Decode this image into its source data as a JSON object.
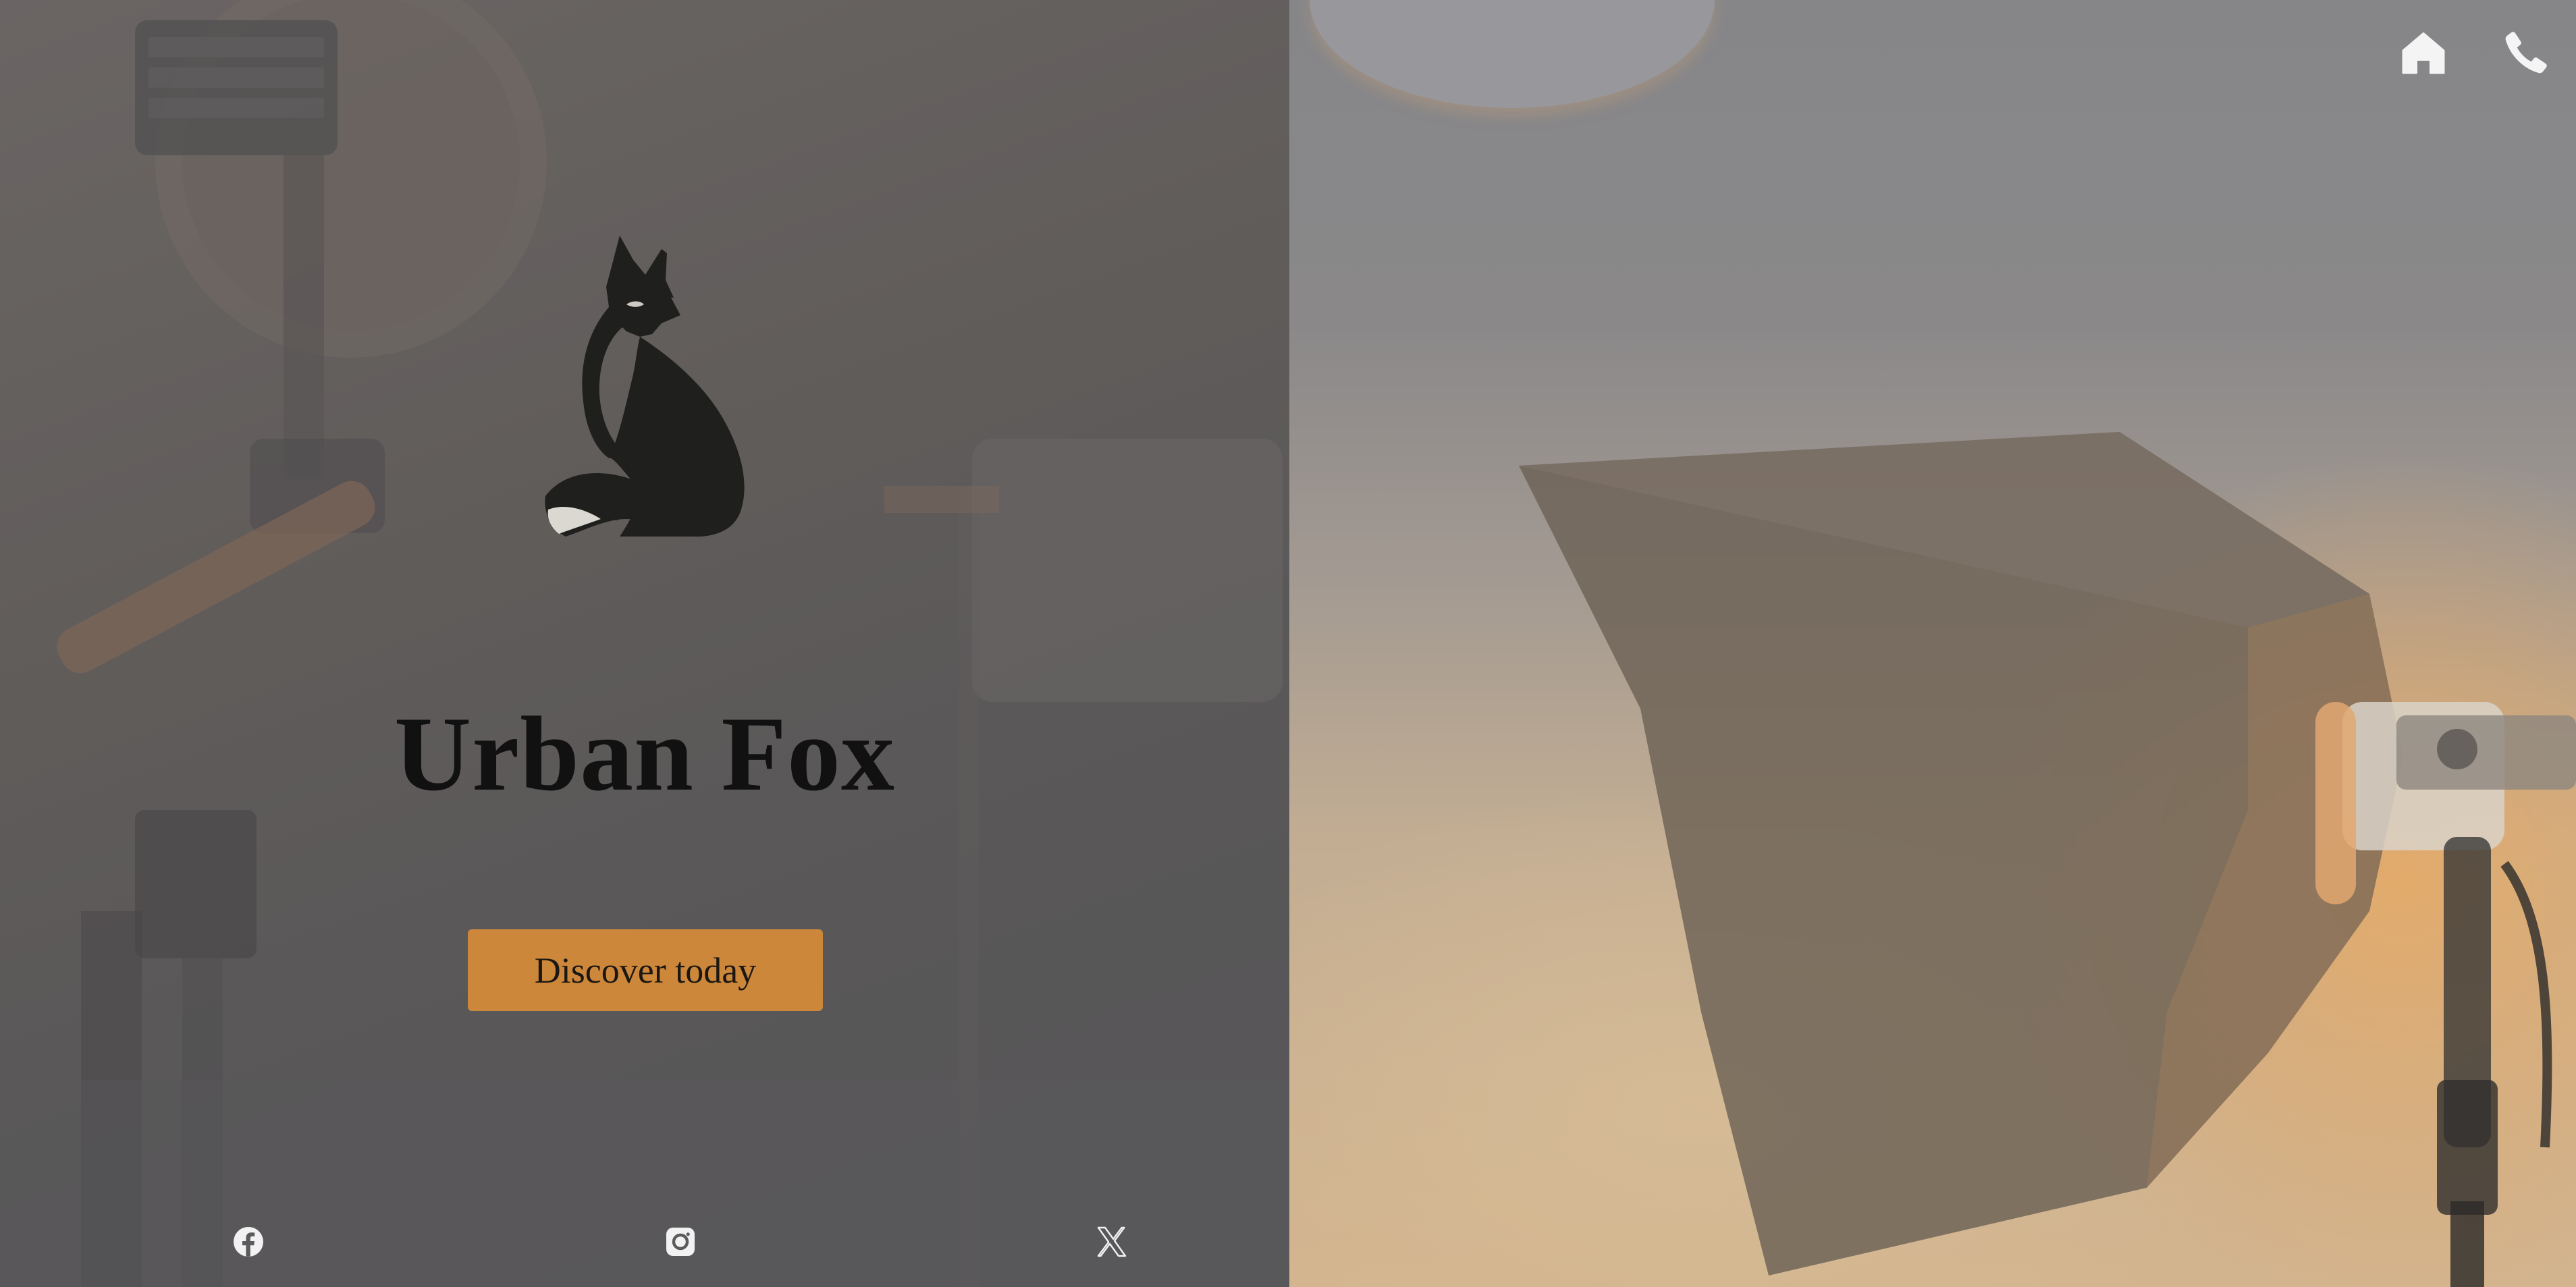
{
  "brand": {
    "name": "Urban Fox"
  },
  "hero": {
    "cta_label": "Discover today"
  },
  "header_nav": {
    "home_icon": "home-icon",
    "phone_icon": "phone-icon"
  },
  "social": {
    "items": [
      {
        "icon": "facebook-icon"
      },
      {
        "icon": "instagram-icon"
      },
      {
        "icon": "x-twitter-icon"
      }
    ]
  },
  "colors": {
    "accent": "#cd873b",
    "logo": "#1f1f1d",
    "text_dark": "#111111",
    "icon_light": "#f2f2f2"
  }
}
